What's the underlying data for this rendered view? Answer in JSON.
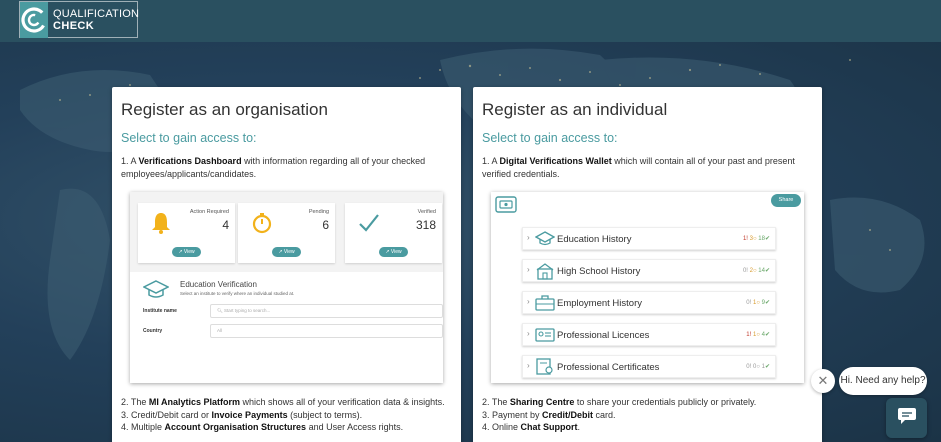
{
  "brand": {
    "line1": "QUALIFICATION",
    "line2": "CHECK",
    "icon": "qc-logo-icon"
  },
  "colors": {
    "accent": "#4a9ba0",
    "header": "#2a5060"
  },
  "org": {
    "title": "Register as an organisation",
    "subtitle": "Select to gain access to:",
    "lead_prefix": "1. A ",
    "lead_bold": "Verifications Dashboard",
    "lead_rest": " with information regarding all of your checked employees/applicants/candidates.",
    "tiles": [
      {
        "label": "Action Required",
        "value": "4",
        "icon": "bell-icon",
        "button": "View"
      },
      {
        "label": "Pending",
        "value": "6",
        "icon": "stopwatch-icon",
        "button": "View"
      },
      {
        "label": "Verified",
        "value": "318",
        "icon": "checkmark-icon",
        "button": "View"
      }
    ],
    "ev_title": "Education Verification",
    "ev_sub": "Select an institute to verify where an individual studied at.",
    "institute_label": "Institute name",
    "institute_placeholder": "Start typing to search...",
    "country_label": "Country",
    "country_value": "All",
    "tail": [
      {
        "pre": "2. The ",
        "bold": "MI Analytics Platform",
        "post": " which shows all of your verification data & insights."
      },
      {
        "pre": "3. Credit/Debit card or ",
        "bold": "Invoice Payments",
        "post": " (subject to terms)."
      },
      {
        "pre": "4. Multiple ",
        "bold": "Account Organisation Structures",
        "post": " and User Access rights."
      }
    ]
  },
  "individual": {
    "title": "Register as an individual",
    "subtitle": "Select to gain access to:",
    "lead_prefix": "1. A ",
    "lead_bold": "Digital Verifications Wallet",
    "lead_rest": " which will contain all of your past and present verified credentials.",
    "share_label": "Share",
    "rows": [
      {
        "label": "Education History",
        "icon": "graduation-cap-icon",
        "a": "1",
        "b": "3",
        "c": "18",
        "a_color": "red"
      },
      {
        "label": "High School History",
        "icon": "school-icon",
        "a": "0",
        "b": "2",
        "c": "14",
        "a_color": "grey"
      },
      {
        "label": "Employment History",
        "icon": "briefcase-icon",
        "a": "0",
        "b": "1",
        "c": "9",
        "a_color": "grey"
      },
      {
        "label": "Professional Licences",
        "icon": "id-card-icon",
        "a": "1",
        "b": "1",
        "c": "4",
        "a_color": "red"
      },
      {
        "label": "Professional Certificates",
        "icon": "certificate-icon",
        "a": "0",
        "b": "0",
        "c": "1",
        "a_color": "grey"
      }
    ],
    "tail": [
      {
        "pre": "2. The ",
        "bold": "Sharing Centre",
        "post": " to share your credentials publicly or privately."
      },
      {
        "pre": "3. Payment by ",
        "bold": "Credit/Debit",
        "post": " card."
      },
      {
        "pre": "4. Online ",
        "bold": "Chat Support",
        "post": "."
      }
    ]
  },
  "chat": {
    "bubble": "Hi. Need any help?",
    "close": "✕"
  }
}
